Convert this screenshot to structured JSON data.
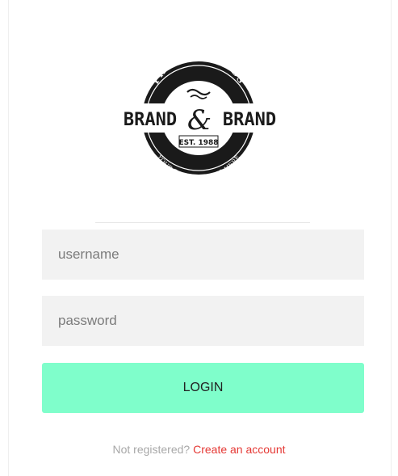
{
  "logo": {
    "top_text": "PREMIUM GOODS",
    "main_left": "BRAND",
    "ampersand": "&",
    "main_right": "BRAND",
    "est": "EST. 1988",
    "bottom_text": "YOUR TAGLINE GOES HERE"
  },
  "form": {
    "username_placeholder": "username",
    "password_placeholder": "password",
    "login_label": "LOGIN",
    "register_prompt": "Not registered? ",
    "register_link": "Create an account"
  },
  "colors": {
    "button_bg": "#7ffecb",
    "link": "#e53935",
    "field_bg": "#f2f2f2"
  }
}
